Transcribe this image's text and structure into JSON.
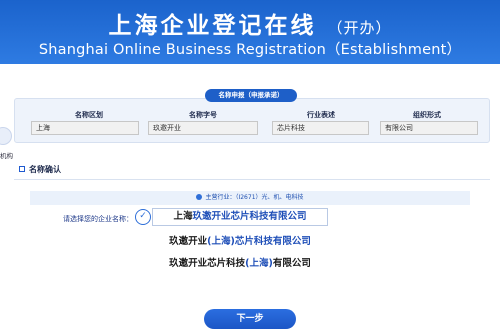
{
  "banner": {
    "title_cn": "上海企业登记在线",
    "title_cn_sub": "（开办）",
    "title_en": "Shanghai Online Business Registration（Establishment）"
  },
  "name_apply": {
    "tab_label": "名称申报（申报承诺）",
    "fields": [
      {
        "label": "名称区划",
        "value": "上海"
      },
      {
        "label": "名称字号",
        "value": "玖邀开业"
      },
      {
        "label": "行业表述",
        "value": "芯片科技"
      },
      {
        "label": "组织形式",
        "value": "有限公司"
      }
    ]
  },
  "side": {
    "text": "机构"
  },
  "confirm": {
    "section_title": "名称确认",
    "industry_text": "主营行业：（I2671）光、机、电科技",
    "choose_label": "请选择您的企业名称：",
    "options": [
      {
        "parts": [
          {
            "t": "上海",
            "hl": false
          },
          {
            "t": "玖邀开业",
            "hl": true
          },
          {
            "t": "芯片科技",
            "hl": true
          },
          {
            "t": "有限公司",
            "hl": true
          }
        ]
      },
      {
        "parts": [
          {
            "t": "玖邀开业",
            "hl": false
          },
          {
            "t": "(上海)",
            "hl": true
          },
          {
            "t": "芯片科技有限公司",
            "hl": true
          }
        ]
      },
      {
        "parts": [
          {
            "t": "玖邀开业芯片科技",
            "hl": false
          },
          {
            "t": "(上海)",
            "hl": true
          },
          {
            "t": "有限公司",
            "hl": false
          }
        ]
      }
    ]
  },
  "next_button": "下一步"
}
